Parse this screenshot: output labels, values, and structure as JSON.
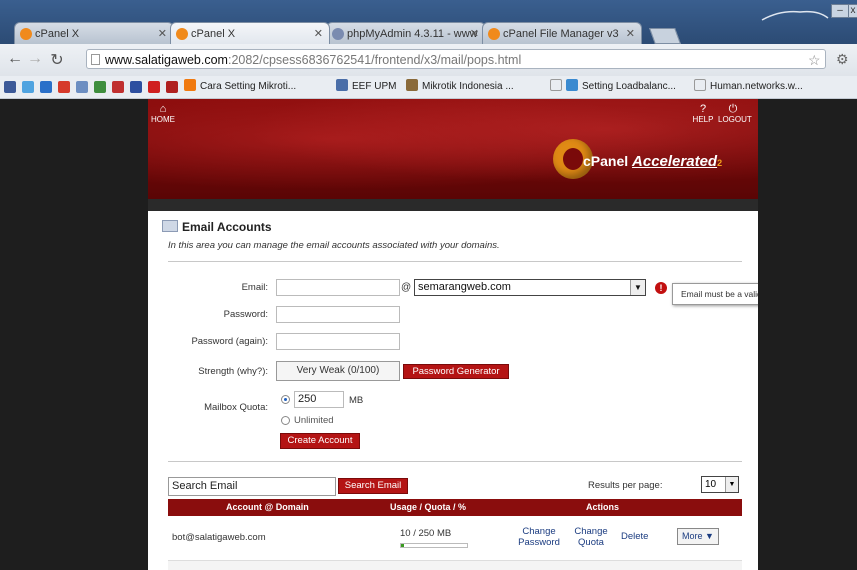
{
  "browser": {
    "tabs": [
      {
        "label": "cPanel X"
      },
      {
        "label": "cPanel X"
      },
      {
        "label": "phpMyAdmin 4.3.11 - www"
      },
      {
        "label": "cPanel File Manager v3"
      }
    ],
    "url": {
      "host": "www.salatigaweb.com",
      "path": ":2082/cpsess683676254​1/frontend/x3/mail/pops.html"
    },
    "bookmarks": [
      {
        "label": "Cara Setting Mikroti..."
      },
      {
        "label": "EEF UPM"
      },
      {
        "label": "Mikrotik Indonesia ..."
      },
      {
        "label": "Setting Loadbalanc..."
      },
      {
        "label": "Human.networks.w..."
      }
    ],
    "window_close_label": "x"
  },
  "header": {
    "home_label": "HOME",
    "help_label": "HELP",
    "logout_label": "LOGOUT",
    "logo_main": "cPanel",
    "logo_accent": "Accelerated",
    "logo_sub": "2"
  },
  "main": {
    "title": "Email Accounts",
    "intro": "In this area you can manage the email accounts associated with your domains.",
    "form": {
      "email_label": "Email:",
      "email_value": "",
      "at_sign": "@",
      "domain_value": "semarangweb.com",
      "error_icon": "!",
      "error_tooltip": "Email must be a valid email address.",
      "password_label": "Password:",
      "password_again_label": "Password (again):",
      "strength_label": "Strength (why?):",
      "strength_value": "Very Weak (0/100)",
      "password_generator_label": "Password Generator",
      "mailbox_quota_label": "Mailbox Quota:",
      "quota_value": "250",
      "quota_unit": "MB",
      "unlimited_label": "Unlimited",
      "create_account_label": "Create Account"
    },
    "search": {
      "value": "Search Email",
      "button_label": "Search Email",
      "results_per_page_label": "Results per page:",
      "results_per_page_value": "10"
    },
    "table": {
      "headers": [
        "Account @ Domain",
        "Usage / Quota / %",
        "Actions"
      ],
      "rows": [
        {
          "account": "bot@salatigaweb.com",
          "usage": "10 / 250 MB",
          "usage_fraction": 0.04,
          "change_password": "Change Password",
          "change_quota": "Change Quota",
          "delete": "Delete",
          "more": "More ▼"
        }
      ]
    }
  }
}
